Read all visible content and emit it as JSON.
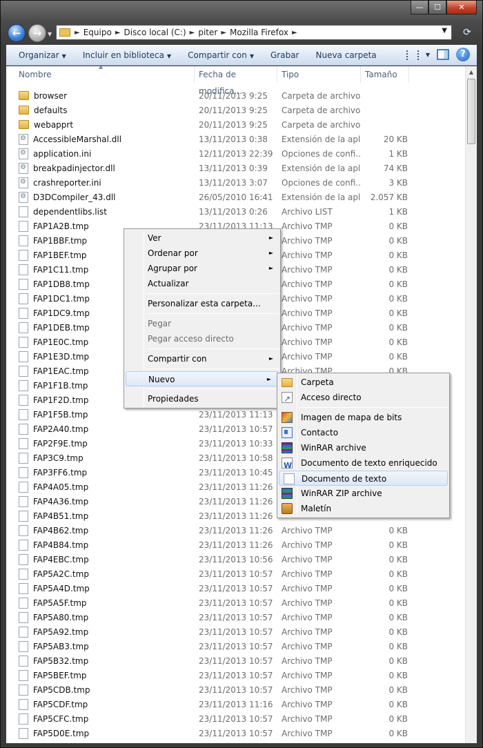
{
  "window": {
    "caption": {
      "minimize": "—",
      "maximize": "☐",
      "close": "✕"
    }
  },
  "nav": {
    "back_icon": "←",
    "forward_icon": "→",
    "breadcrumbs": [
      "Equipo",
      "Disco local (C:)",
      "piter",
      "Mozilla Firefox"
    ],
    "refresh_icon": "⟳"
  },
  "toolbar": {
    "organize": "Organizar",
    "include_library": "Incluir en biblioteca",
    "share_with": "Compartir con",
    "burn": "Grabar",
    "new_folder": "Nueva carpeta",
    "help": "?"
  },
  "columns": {
    "name": "Nombre",
    "date": "Fecha de modifica...",
    "type": "Tipo",
    "size": "Tamaño"
  },
  "files": [
    {
      "name": "browser",
      "date": "20/11/2013 9:25",
      "type": "Carpeta de archivos",
      "size": "",
      "icon": "folder"
    },
    {
      "name": "defaults",
      "date": "20/11/2013 9:25",
      "type": "Carpeta de archivos",
      "size": "",
      "icon": "folder"
    },
    {
      "name": "webapprt",
      "date": "20/11/2013 9:25",
      "type": "Carpeta de archivos",
      "size": "",
      "icon": "folder"
    },
    {
      "name": "AccessibleMarshal.dll",
      "date": "13/11/2013 0:38",
      "type": "Extensión de la apl...",
      "size": "20 KB",
      "icon": "dll"
    },
    {
      "name": "application.ini",
      "date": "12/11/2013 22:39",
      "type": "Opciones de confi...",
      "size": "1 KB",
      "icon": "ini"
    },
    {
      "name": "breakpadinjector.dll",
      "date": "13/11/2013 0:39",
      "type": "Extensión de la apl...",
      "size": "74 KB",
      "icon": "dll"
    },
    {
      "name": "crashreporter.ini",
      "date": "13/11/2013 3:07",
      "type": "Opciones de confi...",
      "size": "3 KB",
      "icon": "ini"
    },
    {
      "name": "D3DCompiler_43.dll",
      "date": "26/05/2010 16:41",
      "type": "Extensión de la apl...",
      "size": "2.057 KB",
      "icon": "dll"
    },
    {
      "name": "dependentlibs.list",
      "date": "13/11/2013 0:26",
      "type": "Archivo LIST",
      "size": "1 KB",
      "icon": "file"
    },
    {
      "name": "FAP1A2B.tmp",
      "date": "23/11/2013 11:13",
      "type": "Archivo TMP",
      "size": "0 KB",
      "icon": "file"
    },
    {
      "name": "FAP1BBF.tmp",
      "date": "",
      "type": "Archivo TMP",
      "size": "0 KB",
      "icon": "file"
    },
    {
      "name": "FAP1BEF.tmp",
      "date": "",
      "type": "Archivo TMP",
      "size": "0 KB",
      "icon": "file"
    },
    {
      "name": "FAP1C11.tmp",
      "date": "",
      "type": "Archivo TMP",
      "size": "0 KB",
      "icon": "file"
    },
    {
      "name": "FAP1DB8.tmp",
      "date": "",
      "type": "Archivo TMP",
      "size": "0 KB",
      "icon": "file"
    },
    {
      "name": "FAP1DC1.tmp",
      "date": "",
      "type": "Archivo TMP",
      "size": "0 KB",
      "icon": "file"
    },
    {
      "name": "FAP1DC9.tmp",
      "date": "",
      "type": "Archivo TMP",
      "size": "0 KB",
      "icon": "file"
    },
    {
      "name": "FAP1DEB.tmp",
      "date": "",
      "type": "Archivo TMP",
      "size": "0 KB",
      "icon": "file"
    },
    {
      "name": "FAP1E0C.tmp",
      "date": "",
      "type": "Archivo TMP",
      "size": "0 KB",
      "icon": "file"
    },
    {
      "name": "FAP1E3D.tmp",
      "date": "",
      "type": "Archivo TMP",
      "size": "0 KB",
      "icon": "file"
    },
    {
      "name": "FAP1EAC.tmp",
      "date": "",
      "type": "Archivo TMP",
      "size": "0 KB",
      "icon": "file"
    },
    {
      "name": "FAP1F1B.tmp",
      "date": "",
      "type": "",
      "size": "",
      "icon": "file"
    },
    {
      "name": "FAP1F2D.tmp",
      "date": "",
      "type": "",
      "size": "",
      "icon": "file"
    },
    {
      "name": "FAP1F5B.tmp",
      "date": "23/11/2013 11:13",
      "type": "",
      "size": "",
      "icon": "file"
    },
    {
      "name": "FAP2A40.tmp",
      "date": "23/11/2013 10:57",
      "type": "",
      "size": "",
      "icon": "file"
    },
    {
      "name": "FAP2F9E.tmp",
      "date": "23/11/2013 10:33",
      "type": "",
      "size": "",
      "icon": "file"
    },
    {
      "name": "FAP3C9.tmp",
      "date": "23/11/2013 10:58",
      "type": "",
      "size": "",
      "icon": "file"
    },
    {
      "name": "FAP3FF6.tmp",
      "date": "23/11/2013 10:45",
      "type": "",
      "size": "",
      "icon": "file"
    },
    {
      "name": "FAP4A05.tmp",
      "date": "23/11/2013 11:26",
      "type": "",
      "size": "",
      "icon": "file"
    },
    {
      "name": "FAP4A36.tmp",
      "date": "23/11/2013 11:26",
      "type": "",
      "size": "",
      "icon": "file"
    },
    {
      "name": "FAP4B51.tmp",
      "date": "23/11/2013 11:26",
      "type": "",
      "size": "",
      "icon": "file"
    },
    {
      "name": "FAP4B62.tmp",
      "date": "23/11/2013 11:26",
      "type": "Archivo TMP",
      "size": "0 KB",
      "icon": "file"
    },
    {
      "name": "FAP4B84.tmp",
      "date": "23/11/2013 11:26",
      "type": "Archivo TMP",
      "size": "0 KB",
      "icon": "file"
    },
    {
      "name": "FAP4EBC.tmp",
      "date": "23/11/2013 10:56",
      "type": "Archivo TMP",
      "size": "0 KB",
      "icon": "file"
    },
    {
      "name": "FAP5A2C.tmp",
      "date": "23/11/2013 10:57",
      "type": "Archivo TMP",
      "size": "0 KB",
      "icon": "file"
    },
    {
      "name": "FAP5A4D.tmp",
      "date": "23/11/2013 10:57",
      "type": "Archivo TMP",
      "size": "0 KB",
      "icon": "file"
    },
    {
      "name": "FAP5A5F.tmp",
      "date": "23/11/2013 10:57",
      "type": "Archivo TMP",
      "size": "0 KB",
      "icon": "file"
    },
    {
      "name": "FAP5A80.tmp",
      "date": "23/11/2013 10:57",
      "type": "Archivo TMP",
      "size": "0 KB",
      "icon": "file"
    },
    {
      "name": "FAP5A92.tmp",
      "date": "23/11/2013 10:57",
      "type": "Archivo TMP",
      "size": "0 KB",
      "icon": "file"
    },
    {
      "name": "FAP5AB3.tmp",
      "date": "23/11/2013 10:57",
      "type": "Archivo TMP",
      "size": "0 KB",
      "icon": "file"
    },
    {
      "name": "FAP5B32.tmp",
      "date": "23/11/2013 10:57",
      "type": "Archivo TMP",
      "size": "0 KB",
      "icon": "file"
    },
    {
      "name": "FAP5BEF.tmp",
      "date": "23/11/2013 10:57",
      "type": "Archivo TMP",
      "size": "0 KB",
      "icon": "file"
    },
    {
      "name": "FAP5CDB.tmp",
      "date": "23/11/2013 10:57",
      "type": "Archivo TMP",
      "size": "0 KB",
      "icon": "file"
    },
    {
      "name": "FAP5CDF.tmp",
      "date": "23/11/2013 11:16",
      "type": "Archivo TMP",
      "size": "0 KB",
      "icon": "file"
    },
    {
      "name": "FAP5CFC.tmp",
      "date": "23/11/2013 10:57",
      "type": "Archivo TMP",
      "size": "0 KB",
      "icon": "file"
    },
    {
      "name": "FAP5D0E.tmp",
      "date": "23/11/2013 10:57",
      "type": "Archivo TMP",
      "size": "0 KB",
      "icon": "file"
    }
  ],
  "context_menu": [
    {
      "label": "Ver",
      "submenu": true
    },
    {
      "label": "Ordenar por",
      "submenu": true
    },
    {
      "label": "Agrupar por",
      "submenu": true
    },
    {
      "label": "Actualizar"
    },
    {
      "separator": true
    },
    {
      "label": "Personalizar esta carpeta..."
    },
    {
      "separator": true
    },
    {
      "label": "Pegar",
      "disabled": true
    },
    {
      "label": "Pegar acceso directo",
      "disabled": true
    },
    {
      "separator": true
    },
    {
      "label": "Compartir con",
      "submenu": true
    },
    {
      "separator": true
    },
    {
      "label": "Nuevo",
      "submenu": true,
      "highlighted": true
    },
    {
      "separator": true
    },
    {
      "label": "Propiedades"
    }
  ],
  "new_submenu": [
    {
      "label": "Carpeta",
      "icon": "folder"
    },
    {
      "label": "Acceso directo",
      "icon": "shortcut"
    },
    {
      "separator": true
    },
    {
      "label": "Imagen de mapa de bits",
      "icon": "bmp"
    },
    {
      "label": "Contacto",
      "icon": "contact"
    },
    {
      "label": "WinRAR archive",
      "icon": "rar"
    },
    {
      "label": "Documento de texto enriquecido",
      "icon": "rtf"
    },
    {
      "label": "Documento de texto",
      "icon": "txt",
      "highlighted": true
    },
    {
      "label": "WinRAR ZIP archive",
      "icon": "zip"
    },
    {
      "label": "Maletín",
      "icon": "case"
    }
  ]
}
